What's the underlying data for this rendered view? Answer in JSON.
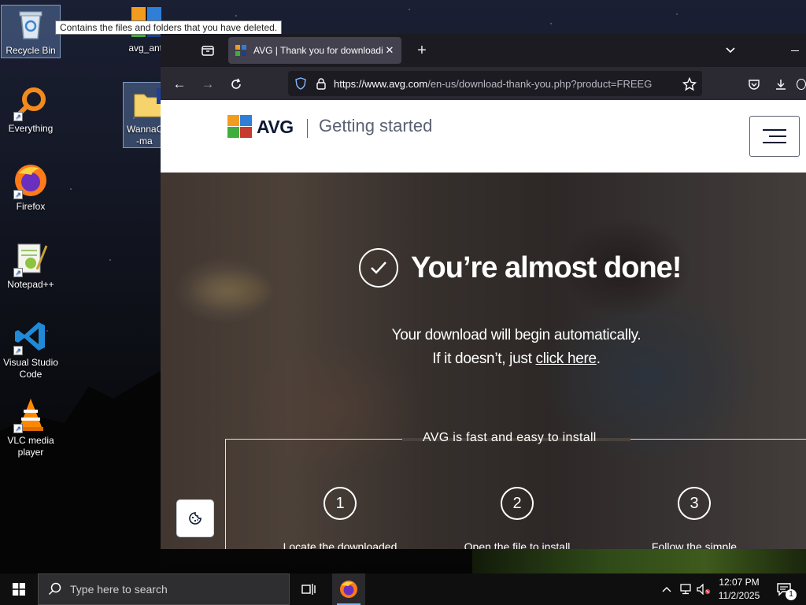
{
  "desktop": {
    "tooltip": "Contains the files and folders that you have deleted.",
    "icons": [
      {
        "label": "Recycle Bin",
        "icon": "recycle-bin-icon"
      },
      {
        "label": "avg_anti",
        "icon": "avg-installer-icon"
      },
      {
        "label": "Everything",
        "icon": "everything-search-icon"
      },
      {
        "label": "WannaC",
        "label2": "-ma",
        "icon": "folder-icon"
      },
      {
        "label": "Firefox",
        "icon": "firefox-icon"
      },
      {
        "label": "Notepad++",
        "icon": "notepad-plus-plus-icon"
      },
      {
        "label": "Visual Studio Code",
        "icon": "vscode-icon"
      },
      {
        "label": "VLC media player",
        "icon": "vlc-icon"
      }
    ]
  },
  "browser": {
    "tab": {
      "title": "AVG | Thank you for downloadi",
      "favicon": "avg-favicon-icon"
    },
    "url": {
      "host": "https://www.avg.com",
      "rest": "/en-us/download-thank-you.php?product=FREEG"
    }
  },
  "page": {
    "header": {
      "brand": "AVG",
      "title": "Getting started"
    },
    "hero": {
      "headline": "You’re almost done!",
      "line1": "Your download will begin automatically.",
      "line2_prefix": "If it doesn’t, just ",
      "line2_link": "click here",
      "line2_suffix": "."
    },
    "install": {
      "title": "AVG is fast and easy to install",
      "steps": [
        {
          "number": "1",
          "label": "Locate the downloaded"
        },
        {
          "number": "2",
          "label": "Open the file to install"
        },
        {
          "number": "3",
          "label": "Follow the simple"
        }
      ]
    }
  },
  "taskbar": {
    "search_placeholder": "Type here to search",
    "time": "12:07 PM",
    "date": "11/2/2025",
    "notification_count": "1"
  },
  "colors": {
    "browser_chrome": "#1c1b22",
    "navbar": "#2b2a33",
    "avg_navy": "#0e1a33",
    "taskbar": "#0f0f10"
  }
}
